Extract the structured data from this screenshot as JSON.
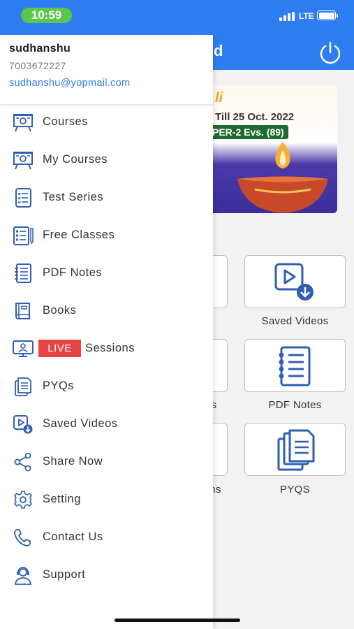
{
  "status_bar": {
    "time": "10:59",
    "network": "LTE"
  },
  "header": {
    "title_fragment": "d"
  },
  "banner": {
    "title_fragment": "li",
    "date_text": "Till 25 Oct. 2022",
    "tag_text": "PER-2 Evs. (89)"
  },
  "grid": {
    "tiles": [
      {
        "label": "Saved Videos",
        "icon": "video-download-icon"
      },
      {
        "label": "PDF Notes",
        "icon": "notebook-icon"
      },
      {
        "label": "PYQS",
        "icon": "documents-icon"
      }
    ],
    "partial_labels": [
      "s",
      "ns"
    ]
  },
  "profile": {
    "name": "sudhanshu",
    "phone": "7003672227",
    "email": "sudhanshu@yopmail.com"
  },
  "menu": {
    "items": [
      {
        "label": "Courses",
        "icon": "presentation-board-icon"
      },
      {
        "label": "My Courses",
        "icon": "presentation-board-icon"
      },
      {
        "label": "Test Series",
        "icon": "checklist-icon"
      },
      {
        "label": "Free Classes",
        "icon": "notes-pencil-icon"
      },
      {
        "label": "PDF Notes",
        "icon": "notebook-icon"
      },
      {
        "label": "Books",
        "icon": "book-icon"
      },
      {
        "label": "Sessions",
        "badge": "LIVE",
        "icon": "video-presenter-icon"
      },
      {
        "label": "PYQs",
        "icon": "documents-icon"
      },
      {
        "label": "Saved Videos",
        "icon": "video-download-icon"
      },
      {
        "label": "Share Now",
        "icon": "share-icon"
      },
      {
        "label": "Setting",
        "icon": "gear-icon"
      },
      {
        "label": "Contact Us",
        "icon": "phone-icon"
      },
      {
        "label": "Support",
        "icon": "support-agent-icon"
      }
    ]
  },
  "colors": {
    "brand_blue": "#2f7df2",
    "live_red": "#e94444",
    "icon_blue": "#2e5fb3",
    "status_green": "#5cc74d"
  }
}
